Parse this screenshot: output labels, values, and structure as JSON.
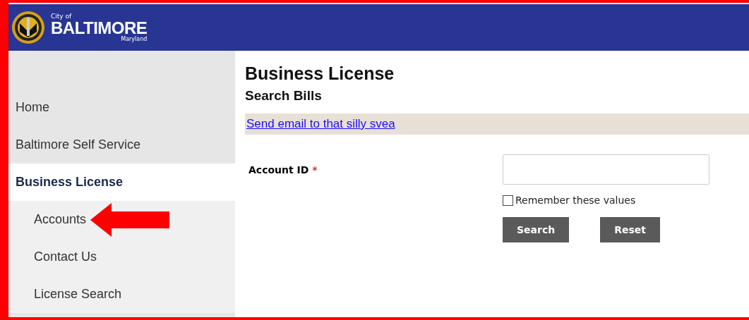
{
  "header": {
    "city_prefix": "City of",
    "city_name": "BALTIMORE",
    "state": "Maryland"
  },
  "sidebar": {
    "items": [
      {
        "label": "Home",
        "selected": false
      },
      {
        "label": "Baltimore Self Service",
        "selected": false
      },
      {
        "label": "Business License",
        "selected": true,
        "children": [
          {
            "label": "Accounts",
            "selected": false,
            "arrow_marker": true
          },
          {
            "label": "Contact Us",
            "selected": false,
            "arrow_marker": false
          },
          {
            "label": "License Search",
            "selected": false,
            "arrow_marker": false
          }
        ]
      }
    ]
  },
  "main": {
    "title": "Business License",
    "subtitle": "Search Bills",
    "notice_link": "Send email to that silly svea",
    "form": {
      "field_label": "Account ID",
      "required_mark": "*",
      "remember_label": "Remember these values",
      "remember_checked": false,
      "buttons": [
        "Search",
        "Reset"
      ]
    }
  }
}
